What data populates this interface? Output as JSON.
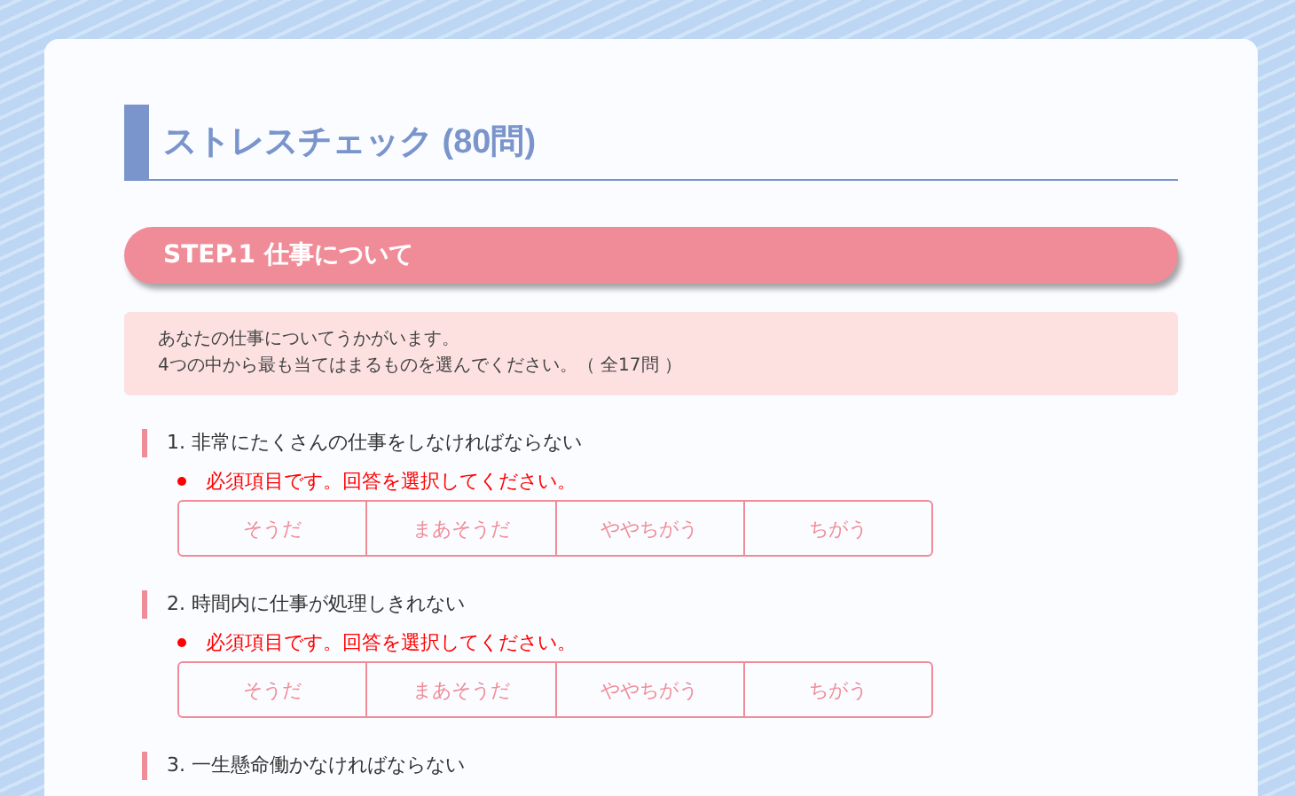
{
  "title": "ストレスチェック (80問)",
  "step": {
    "label": "STEP.1 仕事について"
  },
  "intro": [
    "あなたの仕事についてうかがいます。",
    "4つの中から最も当てはまるものを選んでください。（ 全17問 ）"
  ],
  "questions": [
    {
      "text": "1. 非常にたくさんの仕事をしなければならない",
      "error": "必須項目です。回答を選択してください。",
      "options": [
        {
          "label": "そうだ",
          "selected": false
        },
        {
          "label": "まあそうだ",
          "selected": false
        },
        {
          "label": "ややちがう",
          "selected": false
        },
        {
          "label": "ちがう",
          "selected": false
        }
      ]
    },
    {
      "text": "2. 時間内に仕事が処理しきれない",
      "error": "必須項目です。回答を選択してください。",
      "options": [
        {
          "label": "そうだ",
          "selected": false
        },
        {
          "label": "まあそうだ",
          "selected": false
        },
        {
          "label": "ややちがう",
          "selected": false
        },
        {
          "label": "ちがう",
          "selected": false
        }
      ]
    },
    {
      "text": "3. 一生懸命働かなければならない"
    }
  ]
}
